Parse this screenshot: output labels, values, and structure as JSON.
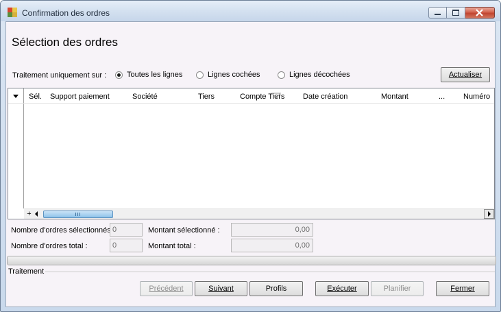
{
  "window": {
    "title": "Confirmation des ordres",
    "icon_name": "app-icon",
    "controls": [
      "minimize-icon",
      "maximize-icon",
      "close-icon"
    ]
  },
  "heading": "Sélection des ordres",
  "filter": {
    "label": "Traitement uniquement sur :",
    "options": [
      {
        "label": "Toutes les lignes",
        "checked": true
      },
      {
        "label": "Lignes cochées",
        "checked": false
      },
      {
        "label": "Lignes décochées",
        "checked": false
      }
    ],
    "refresh_button": "Actualiser"
  },
  "grid": {
    "columns": [
      "Sél.",
      "Support paiement",
      "Société",
      "Tiers",
      "Compte Tiers",
      "Date création",
      "Montant",
      "...",
      "Numéro"
    ],
    "sorted_column": "Compte Tiers",
    "rows": []
  },
  "summary": {
    "selected_count_label": "Nombre d'ordres sélectionnés",
    "selected_count": "0",
    "total_count_label": "Nombre d'ordres total :",
    "total_count": "0",
    "selected_amount_label": "Montant sélectionné :",
    "selected_amount": "0,00",
    "total_amount_label": "Montant total :",
    "total_amount": "0,00"
  },
  "progress": 0,
  "section_label": "Traitement",
  "buttons": {
    "previous": "Précédent",
    "next": "Suivant",
    "profiles": "Profils",
    "execute": "Exécuter",
    "schedule": "Planifier",
    "close": "Fermer"
  },
  "colors": {
    "client_background": "#f7f3f8",
    "close_button": "#c14530",
    "scroll_thumb": "#8ec3ea"
  }
}
